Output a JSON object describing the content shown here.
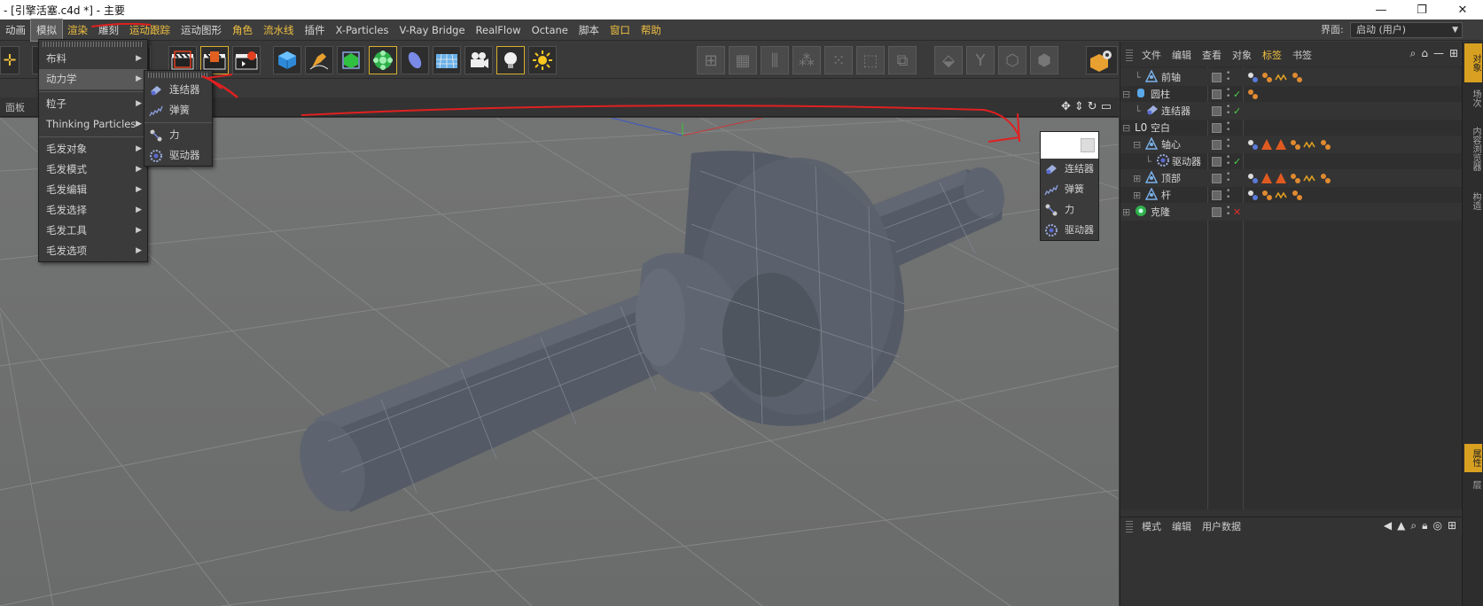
{
  "window": {
    "title": "- [引擎活塞.c4d *] - 主要",
    "minimize_glyph": "—",
    "restore_glyph": "❐",
    "close_glyph": "✕"
  },
  "menubar": {
    "items": [
      {
        "label": "动画",
        "style": "normal"
      },
      {
        "label": "模拟",
        "style": "active"
      },
      {
        "label": "渲染",
        "style": "yellow"
      },
      {
        "label": "雕刻",
        "style": "normal"
      },
      {
        "label": "运动跟踪",
        "style": "yellow"
      },
      {
        "label": "运动图形",
        "style": "normal"
      },
      {
        "label": "角色",
        "style": "yellow"
      },
      {
        "label": "流水线",
        "style": "yellow"
      },
      {
        "label": "插件",
        "style": "normal"
      },
      {
        "label": "X-Particles",
        "style": "normal"
      },
      {
        "label": "V-Ray Bridge",
        "style": "normal"
      },
      {
        "label": "RealFlow",
        "style": "normal"
      },
      {
        "label": "Octane",
        "style": "normal"
      },
      {
        "label": "脚本",
        "style": "normal"
      },
      {
        "label": "窗口",
        "style": "yellow"
      },
      {
        "label": "帮助",
        "style": "yellow"
      }
    ],
    "layout_label": "界面:",
    "layout_value": "启动 (用户)"
  },
  "viewport": {
    "header_items": [
      "面板"
    ],
    "nav_icons": [
      "move-view-icon",
      "scale-view-icon",
      "rotate-view-icon",
      "toggle-view-icon"
    ]
  },
  "simulate_menu": {
    "items": [
      {
        "label": "布料",
        "has_sub": true
      },
      {
        "label": "动力学",
        "has_sub": true,
        "active": true
      },
      {
        "sep": true
      },
      {
        "label": "粒子",
        "has_sub": true
      },
      {
        "label": "Thinking Particles",
        "has_sub": true
      },
      {
        "sep": true
      },
      {
        "label": "毛发对象",
        "has_sub": true
      },
      {
        "label": "毛发模式",
        "has_sub": true
      },
      {
        "label": "毛发编辑",
        "has_sub": true
      },
      {
        "label": "毛发选择",
        "has_sub": true
      },
      {
        "label": "毛发工具",
        "has_sub": true
      },
      {
        "label": "毛发选项",
        "has_sub": true
      }
    ]
  },
  "dynamics_submenu": {
    "items": [
      {
        "label": "连结器",
        "icon": "connector-icon"
      },
      {
        "label": "弹簧",
        "icon": "spring-icon"
      },
      {
        "sep": true
      },
      {
        "label": "力",
        "icon": "force-icon"
      },
      {
        "label": "驱动器",
        "icon": "motor-icon"
      }
    ]
  },
  "palette": {
    "items": [
      {
        "label": "连结器",
        "icon": "connector-icon"
      },
      {
        "label": "弹簧",
        "icon": "spring-icon"
      },
      {
        "sep": true
      },
      {
        "label": "力",
        "icon": "force-icon"
      },
      {
        "label": "驱动器",
        "icon": "motor-icon"
      }
    ]
  },
  "object_manager": {
    "menu": [
      "文件",
      "编辑",
      "查看",
      "对象",
      "标签",
      "书签"
    ],
    "active_menu": "标签",
    "objects": [
      {
        "name": "前轴",
        "icon": "joint-icon",
        "indent": 1,
        "tree": "",
        "check": "",
        "tags": "physics-tags"
      },
      {
        "name": "圆柱",
        "icon": "cylinder-icon",
        "indent": 0,
        "tree": "⊟",
        "check": "✓",
        "tags": "material-tag"
      },
      {
        "name": "连结器",
        "icon": "connector-icon",
        "indent": 1,
        "tree": "",
        "check": "✓",
        "tags": ""
      },
      {
        "name": "空白",
        "icon": "null-icon",
        "indent": 0,
        "tree": "⊟",
        "check": "",
        "tags": ""
      },
      {
        "name": "轴心",
        "icon": "joint-icon",
        "indent": 1,
        "tree": "⊟",
        "check": "",
        "tags": "physics-tags-with-warnings"
      },
      {
        "name": "驱动器",
        "icon": "motor-icon",
        "indent": 2,
        "tree": "",
        "check": "✓",
        "tags": ""
      },
      {
        "name": "顶部",
        "icon": "joint-icon",
        "indent": 1,
        "tree": "⊞",
        "check": "",
        "tags": "physics-tags-with-warnings"
      },
      {
        "name": "杆",
        "icon": "joint-icon",
        "indent": 1,
        "tree": "⊞",
        "check": "",
        "tags": "physics-tags"
      },
      {
        "name": "克隆",
        "icon": "cloner-icon",
        "indent": 0,
        "tree": "⊞",
        "check": "✕",
        "tags": ""
      }
    ]
  },
  "attribute_manager": {
    "menu": [
      "模式",
      "编辑",
      "用户数据"
    ]
  },
  "side_tabs": {
    "top": [
      "对象",
      "场次",
      "内容浏览器",
      "构造"
    ],
    "bottom": [
      "属性",
      "层"
    ]
  },
  "colors": {
    "accent": "#f0c040",
    "viewport_bg": "#6f7070",
    "panel_bg": "#333333"
  }
}
